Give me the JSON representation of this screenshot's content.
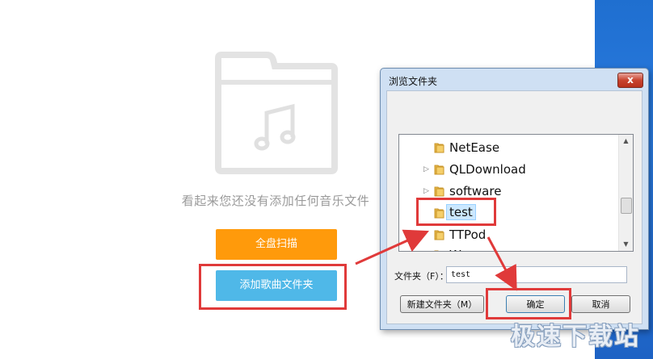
{
  "main": {
    "empty_message": "看起来您还没有添加任何音乐文件",
    "scan_button": "全盘扫描",
    "add_folder_button": "添加歌曲文件夹"
  },
  "dialog": {
    "title": "浏览文件夹",
    "close": "x",
    "tree": [
      {
        "label": "NetEase",
        "expandable": false
      },
      {
        "label": "QLDownload",
        "expandable": true
      },
      {
        "label": "software",
        "expandable": true
      },
      {
        "label": "test",
        "expandable": false,
        "selected": true
      },
      {
        "label": "TTPod",
        "expandable": false
      },
      {
        "label": "We",
        "expandable": false
      }
    ],
    "folder_label": "文件夹（F）：",
    "folder_value": "test",
    "new_folder_button": "新建文件夹（M）",
    "ok_button": "确定",
    "cancel_button": "取消"
  },
  "watermark": "极速下载站",
  "colors": {
    "scan_orange": "#ff9a0b",
    "add_blue": "#4fb8e8",
    "highlight_red": "#e03a3a"
  }
}
